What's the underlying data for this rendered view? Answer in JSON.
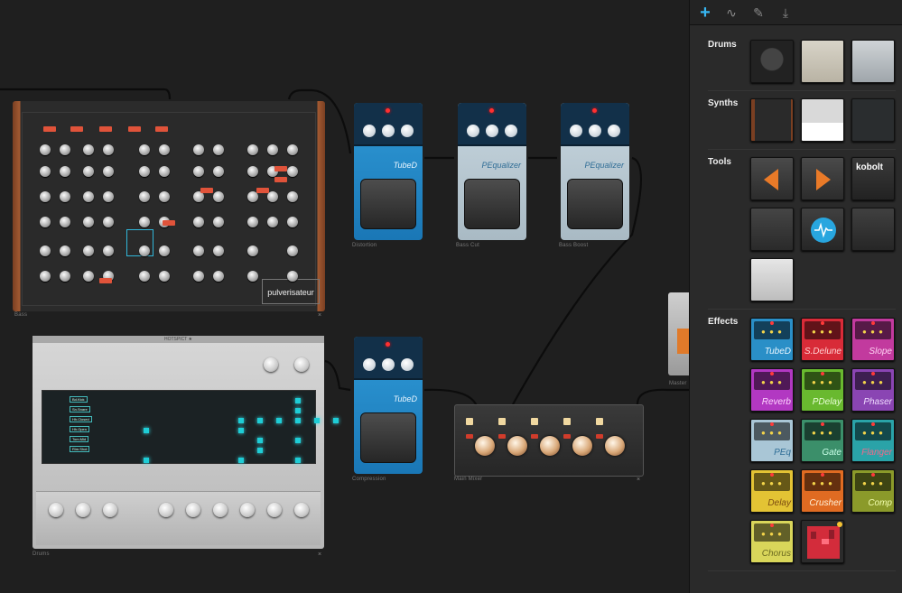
{
  "app": {
    "accent": "#37b5f0"
  },
  "sidebar": {
    "tabs": [
      {
        "name": "add",
        "glyph": "+"
      },
      {
        "name": "waveform",
        "glyph": "∿"
      },
      {
        "name": "wrench",
        "glyph": "✎"
      },
      {
        "name": "export",
        "glyph": "⤓"
      }
    ],
    "sections": {
      "drums": "Drums",
      "synths": "Synths",
      "tools": "Tools",
      "effects": "Effects"
    },
    "tools_kobolt": "kobolt",
    "effects": [
      {
        "label": "TubeD",
        "color": "#2a8fc7",
        "text": "#e9f6ff"
      },
      {
        "label": "S.Delune",
        "color": "#d82b38",
        "text": "#ffd2d2"
      },
      {
        "label": "Slope",
        "color": "#c23a9e",
        "text": "#ffd3f3"
      },
      {
        "label": "Reverb",
        "color": "#b238c2",
        "text": "#ffd7ff"
      },
      {
        "label": "PDelay",
        "color": "#69b92f",
        "text": "#eaffd8"
      },
      {
        "label": "Phaser",
        "color": "#8a45b3",
        "text": "#f0dcff"
      },
      {
        "label": "PEq",
        "color": "#a9c6d6",
        "text": "#2f6d96"
      },
      {
        "label": "Gate",
        "color": "#3b8f6a",
        "text": "#c8ffe8"
      },
      {
        "label": "Flanger",
        "color": "#2aa3a8",
        "text": "#f06a8a"
      },
      {
        "label": "Delay",
        "color": "#e3c334",
        "text": "#7a4a10"
      },
      {
        "label": "Crusher",
        "color": "#e06b22",
        "text": "#fff1d8"
      },
      {
        "label": "Comp",
        "color": "#8b9a2a",
        "text": "#f3ffb0"
      },
      {
        "label": "Chorus",
        "color": "#d9d65a",
        "text": "#6b6a20"
      }
    ]
  },
  "canvas": {
    "synth": {
      "brand": "pulverisateur",
      "label": "Bass"
    },
    "drums": {
      "brand": "HOTSPICT ★",
      "label": "Drums",
      "tracks": [
        "Bd.Kick",
        "Sn.Snare",
        "Hh.Closed",
        "Hh.Open",
        "Tom.Mid",
        "Rim.Shot"
      ]
    },
    "pedals": [
      {
        "name": "TubeD",
        "label": "Distortion"
      },
      {
        "name": "PEqualizer",
        "label": "Bass Cut"
      },
      {
        "name": "PEqualizer",
        "label": "Bass Boost"
      },
      {
        "name": "TubeD",
        "label": "Compression"
      }
    ],
    "mixer": {
      "label": "Main Mixer"
    },
    "partial": {
      "label": "Master"
    }
  }
}
